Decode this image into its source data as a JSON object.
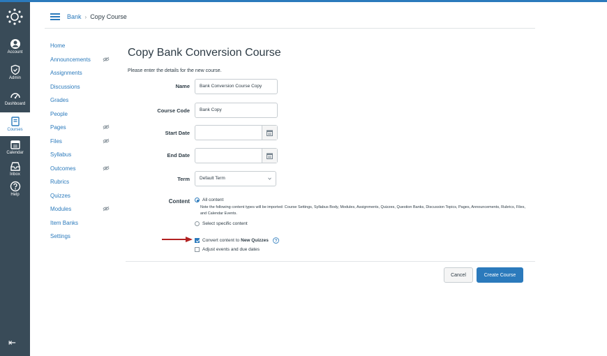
{
  "colors": {
    "brand": "#2b7abc",
    "nav_bg": "#394b58",
    "arrow": "#b22222"
  },
  "global_nav": {
    "items": [
      {
        "label": "Account",
        "icon": "user-circle-icon"
      },
      {
        "label": "Admin",
        "icon": "shield-icon"
      },
      {
        "label": "Dashboard",
        "icon": "speedometer-icon"
      },
      {
        "label": "Courses",
        "icon": "book-icon",
        "active": true
      },
      {
        "label": "Calendar",
        "icon": "calendar-icon"
      },
      {
        "label": "Inbox",
        "icon": "inbox-icon"
      },
      {
        "label": "Help",
        "icon": "help-icon"
      }
    ]
  },
  "breadcrumb": {
    "course": "Bank",
    "separator": "›",
    "current": "Copy Course"
  },
  "course_nav": {
    "items": [
      {
        "label": "Home",
        "eye": false
      },
      {
        "label": "Announcements",
        "eye": true
      },
      {
        "label": "Assignments",
        "eye": false
      },
      {
        "label": "Discussions",
        "eye": false
      },
      {
        "label": "Grades",
        "eye": false
      },
      {
        "label": "People",
        "eye": false
      },
      {
        "label": "Pages",
        "eye": true
      },
      {
        "label": "Files",
        "eye": true
      },
      {
        "label": "Syllabus",
        "eye": false
      },
      {
        "label": "Outcomes",
        "eye": true
      },
      {
        "label": "Rubrics",
        "eye": false
      },
      {
        "label": "Quizzes",
        "eye": false
      },
      {
        "label": "Modules",
        "eye": true
      },
      {
        "label": "Item Banks",
        "eye": false
      },
      {
        "label": "Settings",
        "eye": false
      }
    ]
  },
  "form": {
    "title": "Copy Bank Conversion Course",
    "intro": "Please enter the details for the new course.",
    "name_label": "Name",
    "name_value": "Bank Conversion Course Copy",
    "code_label": "Course Code",
    "code_value": "Bank Copy",
    "start_label": "Start Date",
    "start_value": "",
    "end_label": "End Date",
    "end_value": "",
    "term_label": "Term",
    "term_value": "Default Term",
    "content_label": "Content",
    "all_content": "All content",
    "note": "Note the following content types will be imported: Course Settings, Syllabus Body, Modules, Assignments, Quizzes, Question Banks, Discussion Topics, Pages, Announcements, Rubrics, Files, and Calendar Events.",
    "select_specific": "Select specific content",
    "convert_prefix": "Convert content to ",
    "convert_bold": "New Quizzes",
    "convert_checked": true,
    "adjust_label": "Adjust events and due dates",
    "adjust_checked": false
  },
  "actions": {
    "cancel": "Cancel",
    "create": "Create Course"
  }
}
